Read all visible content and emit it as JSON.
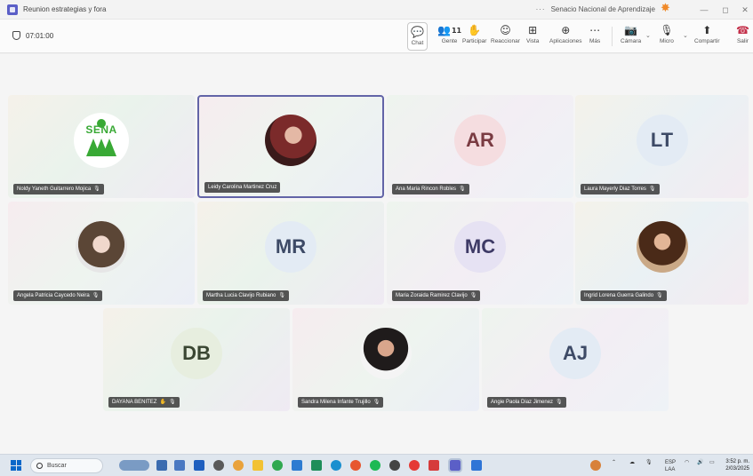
{
  "window": {
    "title": "Reunion estrategias y fora",
    "org": "Senacio Nacional de Aprendizaje",
    "more": "···"
  },
  "toolbar": {
    "timer": "07:01:00",
    "chat": "Chat",
    "people": "Gente",
    "people_count": "11",
    "raise": "Participar",
    "react": "Reaccionar",
    "view": "Vista",
    "apps": "Aplicaciones",
    "more": "Más",
    "camera": "Cámara",
    "mic": "Micro",
    "share": "Compartir",
    "leave": "Salir"
  },
  "participants": [
    {
      "name": "Noldy Yaneth Guitarrero Mojica",
      "type": "logo",
      "logo_text": "SENA"
    },
    {
      "name": "Leidy Carolina Martinez Cruz",
      "type": "photo"
    },
    {
      "name": "Ana Maria Rincon Robles",
      "type": "initials",
      "initials": "AR"
    },
    {
      "name": "Laura Mayerly Diaz Torres",
      "type": "initials",
      "initials": "LT"
    },
    {
      "name": "Angela Patricia Caycedo Neira",
      "type": "photo"
    },
    {
      "name": "Martha Lucia Clavijo Rubiano",
      "type": "initials",
      "initials": "MR"
    },
    {
      "name": "Maria Zoraida Ramirez Clavijo",
      "type": "initials",
      "initials": "MC"
    },
    {
      "name": "Ingrid Lorena Guerra Galindo",
      "type": "photo"
    },
    {
      "name": "DAYANA BENITEZ",
      "type": "initials",
      "initials": "DB"
    },
    {
      "name": "Sandra Milena Infante Trujillo",
      "type": "photo"
    },
    {
      "name": "Angie Paola Diaz Jimenez",
      "type": "initials",
      "initials": "AJ"
    }
  ],
  "taskbar": {
    "search": "Buscar",
    "lang": "ESP",
    "lang2": "LAA",
    "time": "3:52 p. m.",
    "date": "2/03/2025"
  },
  "colors": {
    "accent": "#6264a7",
    "sena_green": "#39a935",
    "leave_red": "#c4314b"
  }
}
